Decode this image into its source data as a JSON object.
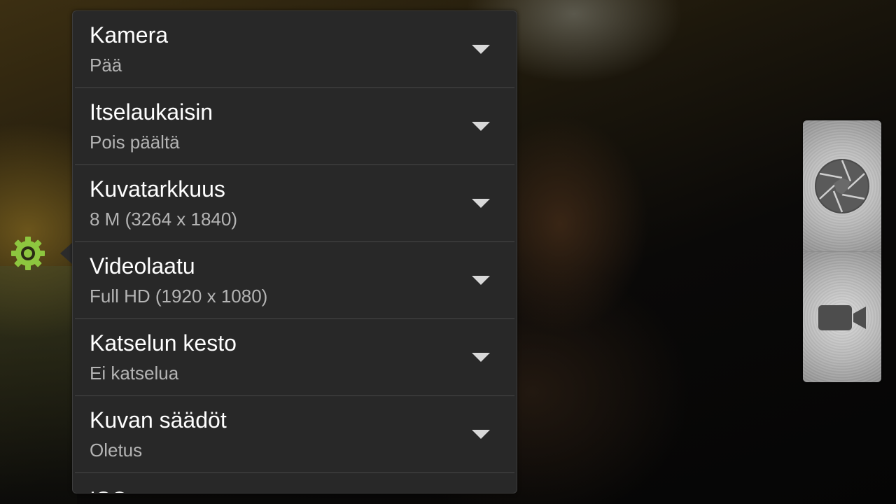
{
  "settings": [
    {
      "title": "Kamera",
      "value": "Pää"
    },
    {
      "title": "Itselaukaisin",
      "value": "Pois päältä"
    },
    {
      "title": "Kuvatarkkuus",
      "value": "8 M (3264 x 1840)"
    },
    {
      "title": "Videolaatu",
      "value": "Full HD (1920 x 1080)"
    },
    {
      "title": "Katselun kesto",
      "value": "Ei katselua"
    },
    {
      "title": "Kuvan säädöt",
      "value": "Oletus"
    },
    {
      "title": "ISO"
    }
  ],
  "icons": {
    "settings": "gear-icon",
    "dropdown": "chevron-down-icon",
    "camera_mode": "aperture-icon",
    "video_mode": "video-camera-icon"
  },
  "colors": {
    "panel_background": "#282828",
    "accent_gear": "#8bc34a",
    "title_text": "#ffffff",
    "value_text": "#b4b4b4"
  }
}
